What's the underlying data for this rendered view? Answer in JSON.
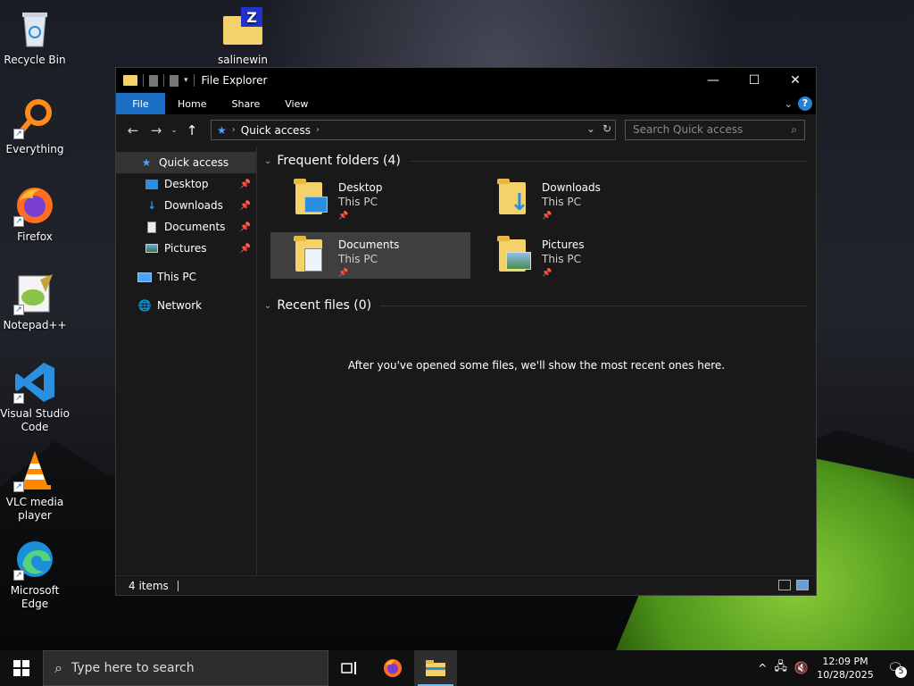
{
  "desktop": {
    "icons": [
      {
        "label": "Recycle Bin"
      },
      {
        "label": "salinewin"
      },
      {
        "label": "Everything"
      },
      {
        "label": "Firefox"
      },
      {
        "label": "Notepad++"
      },
      {
        "label": "Visual Studio Code"
      },
      {
        "label": "VLC media player"
      },
      {
        "label": "Microsoft Edge"
      }
    ]
  },
  "window": {
    "title": "File Explorer",
    "ribbon_tabs": [
      "File",
      "Home",
      "Share",
      "View"
    ],
    "address": {
      "crumb": "Quick access"
    },
    "search": {
      "placeholder": "Search Quick access"
    },
    "nav_pane": {
      "items": [
        {
          "label": "Quick access",
          "icon": "star-icon"
        },
        {
          "label": "Desktop",
          "icon": "desktop-icon",
          "pinned": true
        },
        {
          "label": "Downloads",
          "icon": "download-icon",
          "pinned": true
        },
        {
          "label": "Documents",
          "icon": "document-icon",
          "pinned": true
        },
        {
          "label": "Pictures",
          "icon": "picture-icon",
          "pinned": true
        },
        {
          "label": "This PC",
          "icon": "computer-icon"
        },
        {
          "label": "Network",
          "icon": "network-icon"
        }
      ]
    },
    "frequent": {
      "header": "Frequent folders (4)",
      "folders": [
        {
          "name": "Desktop",
          "location": "This PC"
        },
        {
          "name": "Downloads",
          "location": "This PC"
        },
        {
          "name": "Documents",
          "location": "This PC"
        },
        {
          "name": "Pictures",
          "location": "This PC"
        }
      ]
    },
    "recent": {
      "header": "Recent files (0)",
      "empty_message": "After you've opened some files, we'll show the most recent ones here."
    },
    "status": {
      "items": "4 items"
    }
  },
  "taskbar": {
    "search_placeholder": "Type here to search",
    "time": "12:09 PM",
    "date": "10/28/2025",
    "notification_count": "5"
  },
  "colors": {
    "accent": "#1a6fc4",
    "folder": "#f3d26a"
  }
}
